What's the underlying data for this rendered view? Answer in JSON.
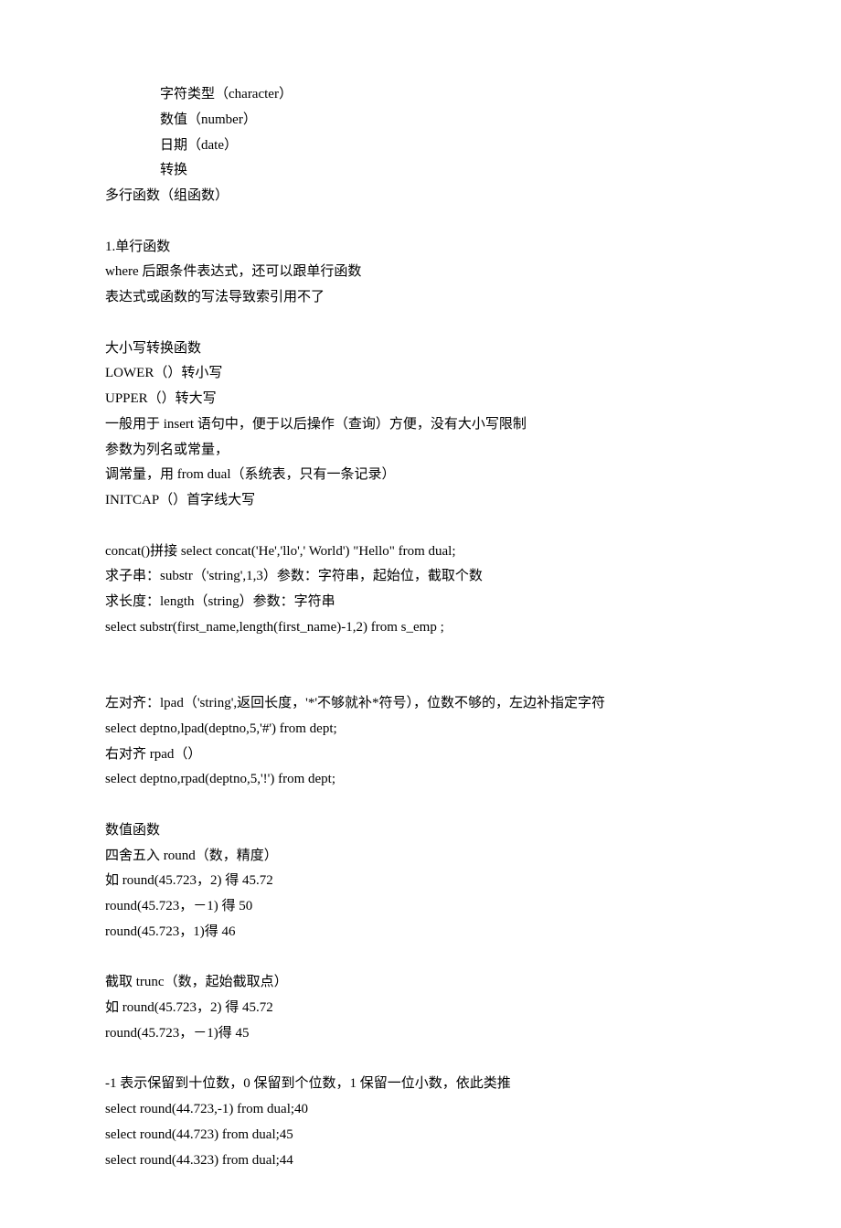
{
  "lines": {
    "l1": "字符类型（character）",
    "l2": "数值（number）",
    "l3": "日期（date）",
    "l4": "转换",
    "l5": "多行函数（组函数）",
    "l6": "1.单行函数",
    "l7": "where 后跟条件表达式，还可以跟单行函数",
    "l8": "表达式或函数的写法导致索引用不了",
    "l9": "大小写转换函数",
    "l10": "LOWER（）转小写",
    "l11": "UPPER（）转大写",
    "l12": "一般用于 insert 语句中，便于以后操作（查询）方便，没有大小写限制",
    "l13": "参数为列名或常量，",
    "l14": "调常量，用 from dual（系统表，只有一条记录）",
    "l15": "INITCAP（）首字线大写",
    "l16": "concat()拼接  select concat('He','llo',' World') \"Hello\" from dual;",
    "l17": "求子串：substr（'string',1,3）参数：字符串，起始位，截取个数",
    "l18": "求长度：length（string）参数：字符串",
    "l19": "select substr(first_name,length(first_name)-1,2) from s_emp ;",
    "l20": "左对齐：lpad（'string',返回长度，'*'不够就补*符号），位数不够的，左边补指定字符",
    "l21": "select deptno,lpad(deptno,5,'#') from dept;",
    "l22": "右对齐 rpad（）",
    "l23": "select deptno,rpad(deptno,5,'!') from dept;",
    "l24": "数值函数",
    "l25": "四舍五入 round（数，精度）",
    "l26": "如 round(45.723，2) 得 45.72",
    "l27": " round(45.723，－1) 得 50",
    "l28": " round(45.723，1)得 46",
    "l29": "截取 trunc（数，起始截取点）",
    "l30": "如 round(45.723，2) 得 45.72",
    "l31": "round(45.723，－1)得 45",
    "l32": "-1 表示保留到十位数，0 保留到个位数，1 保留一位小数，依此类推",
    "l33": "select round(44.723,-1) from dual;40",
    "l34": "select round(44.723) from dual;45",
    "l35": "select round(44.323) from dual;44"
  }
}
